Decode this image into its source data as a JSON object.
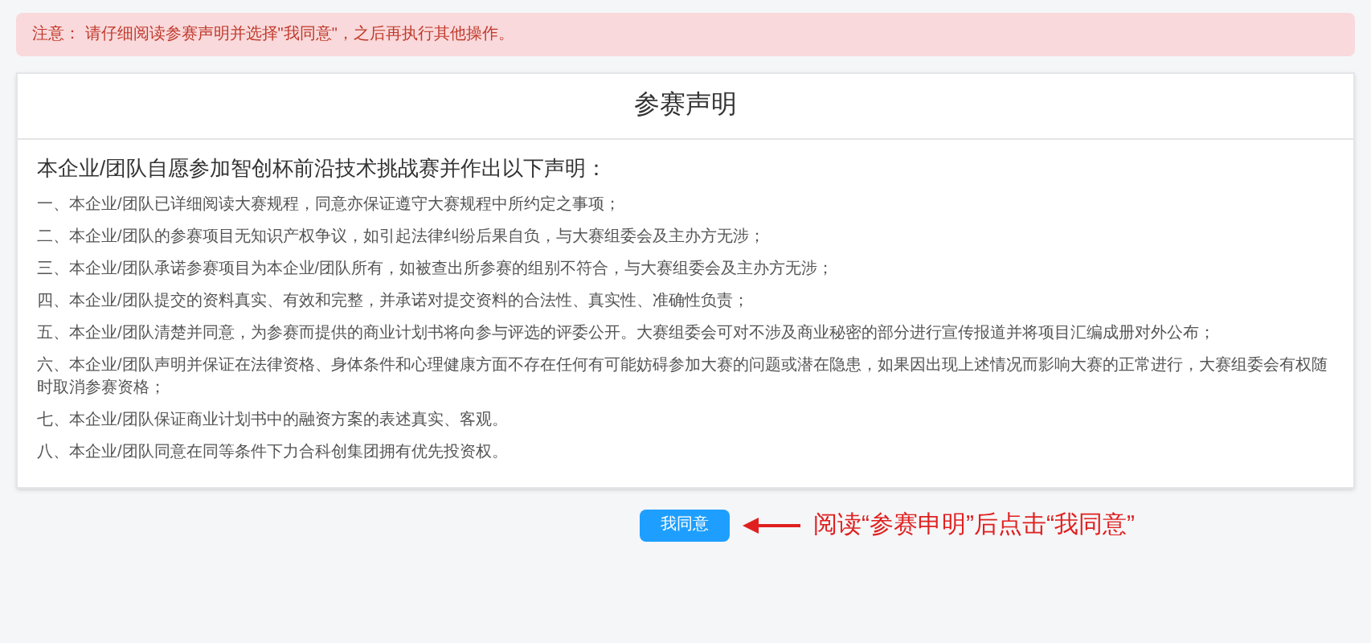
{
  "notice": "注意： 请仔细阅读参赛声明并选择\"我同意\"，之后再执行其他操作。",
  "card": {
    "title": "参赛声明",
    "heading": "本企业/团队自愿参加智创杯前沿技术挑战赛并作出以下声明：",
    "items": [
      "一、本企业/团队已详细阅读大赛规程，同意亦保证遵守大赛规程中所约定之事项；",
      "二、本企业/团队的参赛项目无知识产权争议，如引起法律纠纷后果自负，与大赛组委会及主办方无涉；",
      "三、本企业/团队承诺参赛项目为本企业/团队所有，如被查出所参赛的组别不符合，与大赛组委会及主办方无涉；",
      "四、本企业/团队提交的资料真实、有效和完整，并承诺对提交资料的合法性、真实性、准确性负责；",
      "五、本企业/团队清楚并同意，为参赛而提供的商业计划书将向参与评选的评委公开。大赛组委会可对不涉及商业秘密的部分进行宣传报道并将项目汇编成册对外公布；",
      "六、本企业/团队声明并保证在法律资格、身体条件和心理健康方面不存在任何有可能妨碍参加大赛的问题或潜在隐患，如果因出现上述情况而影响大赛的正常进行，大赛组委会有权随时取消参赛资格；",
      "七、本企业/团队保证商业计划书中的融资方案的表述真实、客观。",
      "八、本企业/团队同意在同等条件下力合科创集团拥有优先投资权。"
    ]
  },
  "agree_button": "我同意",
  "hint": "阅读“参赛申明”后点击“我同意”"
}
